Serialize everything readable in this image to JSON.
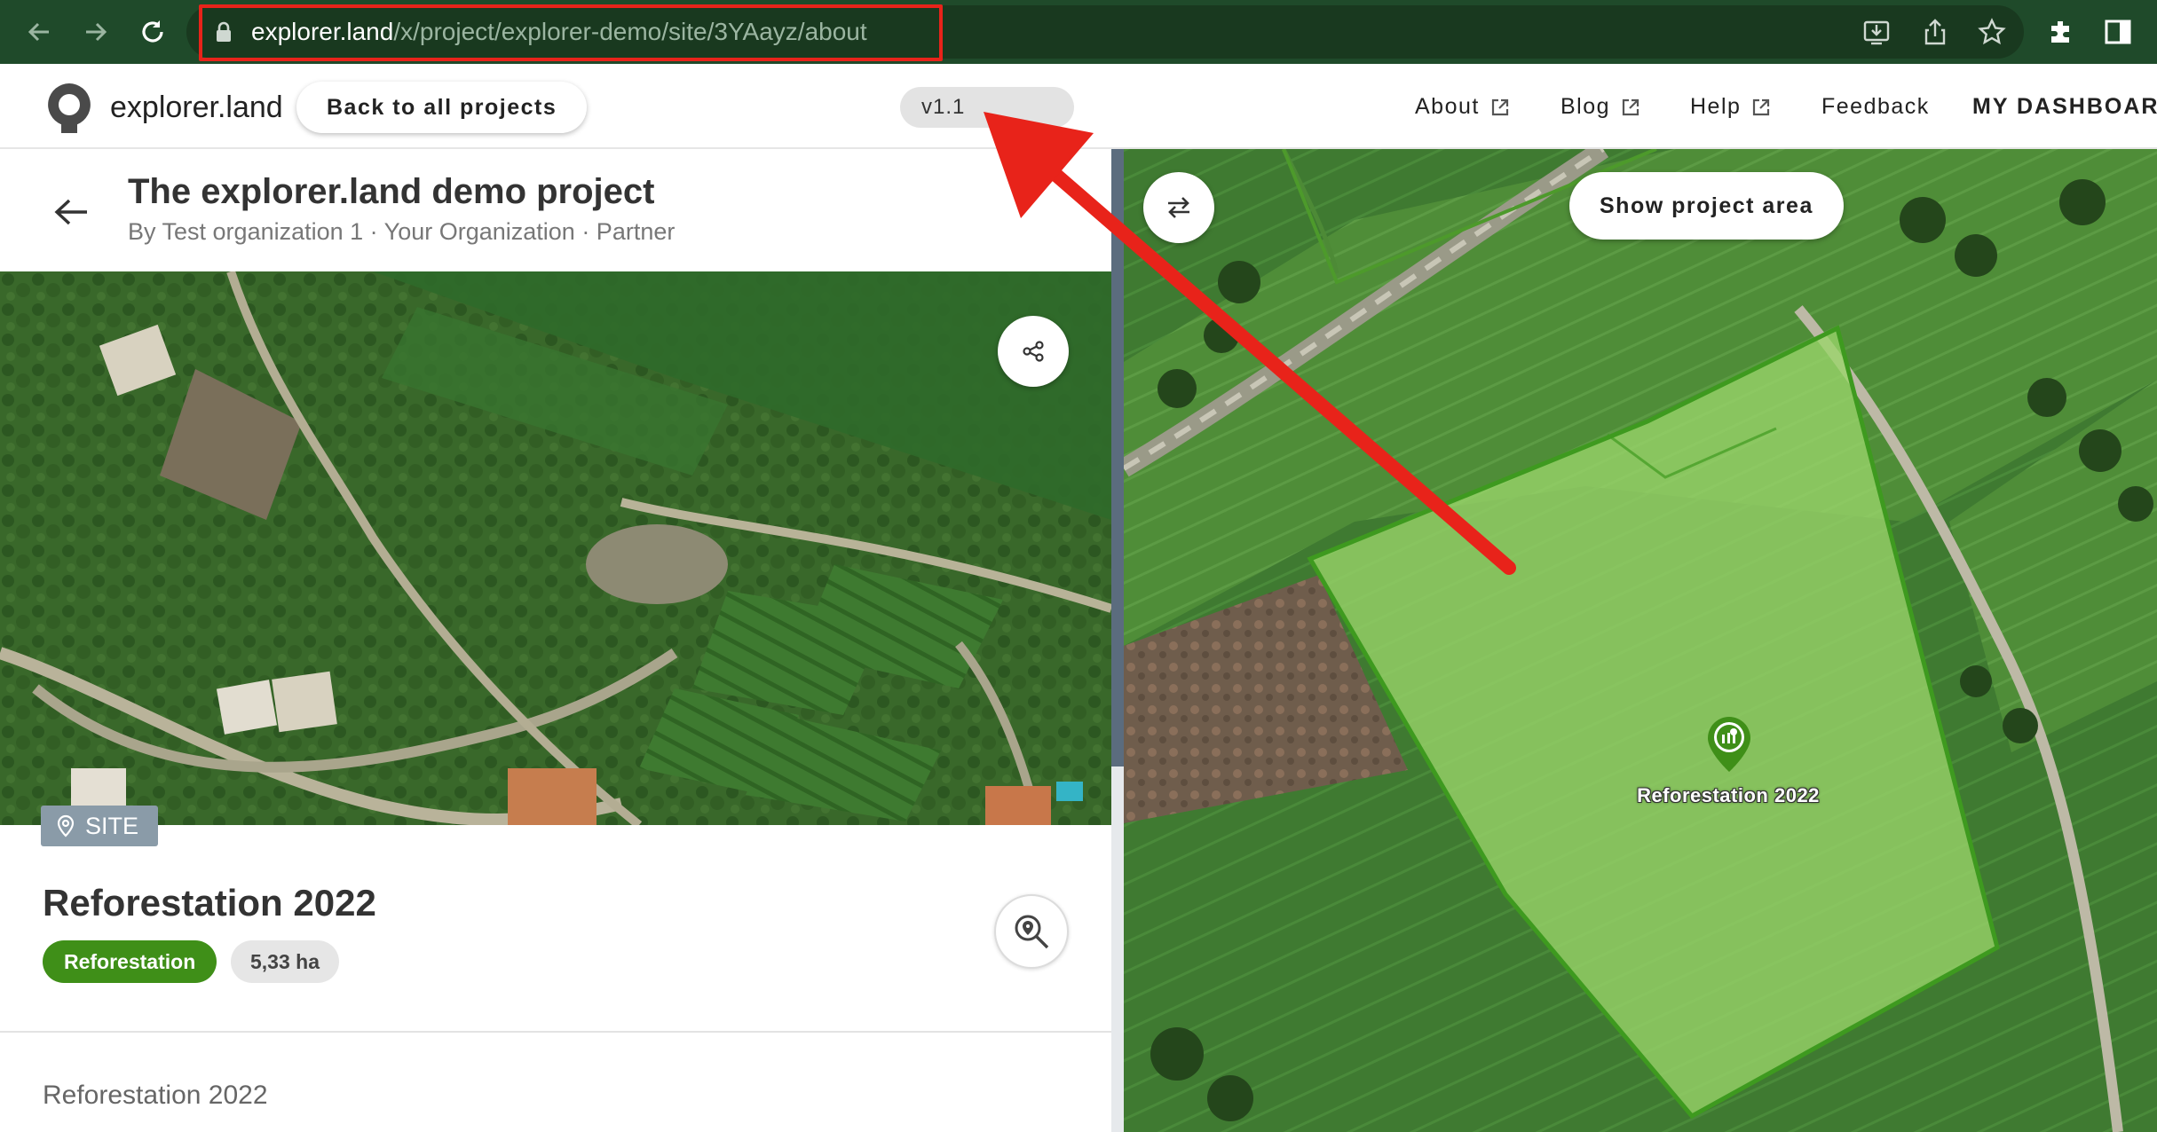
{
  "browser": {
    "url_host": "explorer.land",
    "url_path": "/x/project/explorer-demo/site/3YAayz/about"
  },
  "header": {
    "logo_text": "explorer.land",
    "back_button": "Back to all projects",
    "version": "v1.1",
    "nav": {
      "about": "About",
      "blog": "Blog",
      "help": "Help",
      "feedback": "Feedback",
      "dashboard": "MY DASHBOARD"
    }
  },
  "project": {
    "title": "The explorer.land demo project",
    "subtitle": "By Test organization 1 · Your Organization · Partner"
  },
  "site": {
    "badge": "SITE",
    "name": "Reforestation 2022",
    "tag": "Reforestation",
    "area": "5,33 ha",
    "description": "Reforestation 2022"
  },
  "map": {
    "show_area_button": "Show project area",
    "site_label": "Reforestation 2022"
  },
  "colors": {
    "chrome": "#1f4a2a",
    "annotation": "#e8231a",
    "accent_green": "#3f8f18",
    "polygon_fill": "#8fcf5e"
  }
}
